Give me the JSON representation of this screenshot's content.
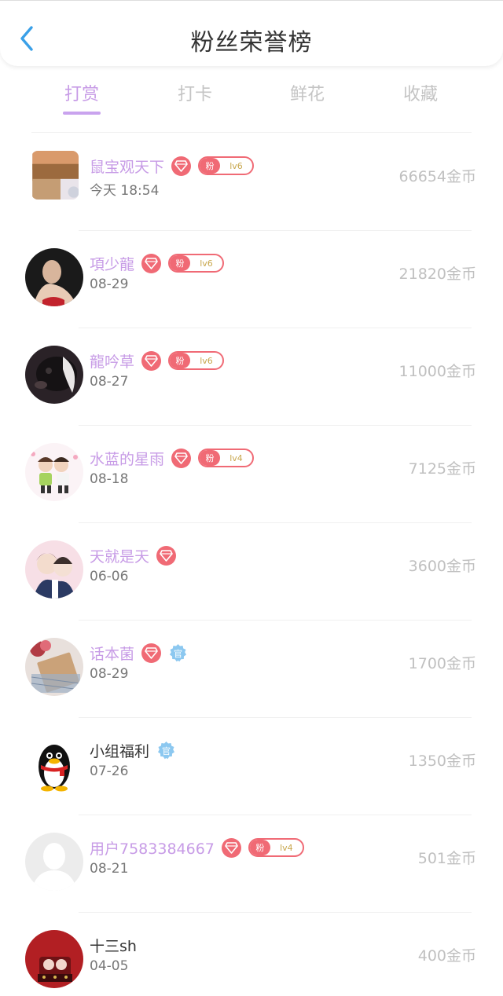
{
  "header": {
    "title": "粉丝荣誉榜"
  },
  "tabs": [
    {
      "label": "打赏",
      "active": true
    },
    {
      "label": "打卡",
      "active": false
    },
    {
      "label": "鲜花",
      "active": false
    },
    {
      "label": "收藏",
      "active": false
    }
  ],
  "colors": {
    "accent": "#c79be6",
    "badge_red": "#f06a75",
    "official_blue": "#8cc8f0"
  },
  "rows": [
    {
      "name": "鼠宝观天下",
      "date": "今天 18:54",
      "amount": "66654金币",
      "diamond": true,
      "official": false,
      "fan_label": "粉",
      "level": "lv6",
      "avatar_icon": "landscape-avatar"
    },
    {
      "name": "項少龍",
      "date": "08-29",
      "amount": "21820金币",
      "diamond": true,
      "official": false,
      "fan_label": "粉",
      "level": "lv6",
      "avatar_icon": "portrait-avatar"
    },
    {
      "name": "龍吟草",
      "date": "08-27",
      "amount": "11000金币",
      "diamond": true,
      "official": false,
      "fan_label": "粉",
      "level": "lv6",
      "avatar_icon": "dog-avatar"
    },
    {
      "name": "水蓝的星雨",
      "date": "08-18",
      "amount": "7125金币",
      "diamond": true,
      "official": false,
      "fan_label": "粉",
      "level": "lv4",
      "avatar_icon": "cartoon-avatar"
    },
    {
      "name": "天就是天",
      "date": "06-06",
      "amount": "3600金币",
      "diamond": true,
      "official": false,
      "fan_label": "",
      "level": "",
      "avatar_icon": "anime-avatar"
    },
    {
      "name": "话本菌",
      "date": "08-29",
      "amount": "1700金币",
      "diamond": true,
      "official": true,
      "official_label": "官",
      "fan_label": "",
      "level": "",
      "avatar_icon": "book-avatar"
    },
    {
      "name": "小组福利",
      "date": "07-26",
      "amount": "1350金币",
      "diamond": false,
      "official": true,
      "official_label": "官",
      "fan_label": "",
      "level": "",
      "avatar_icon": "penguin-avatar"
    },
    {
      "name": "用户7583384667",
      "date": "08-21",
      "amount": "501金币",
      "diamond": true,
      "official": false,
      "fan_label": "粉",
      "level": "lv4",
      "avatar_icon": "default-avatar"
    },
    {
      "name": "十三sh",
      "date": "04-05",
      "amount": "400金币",
      "diamond": false,
      "official": false,
      "fan_label": "",
      "level": "",
      "avatar_icon": "red-avatar"
    }
  ]
}
